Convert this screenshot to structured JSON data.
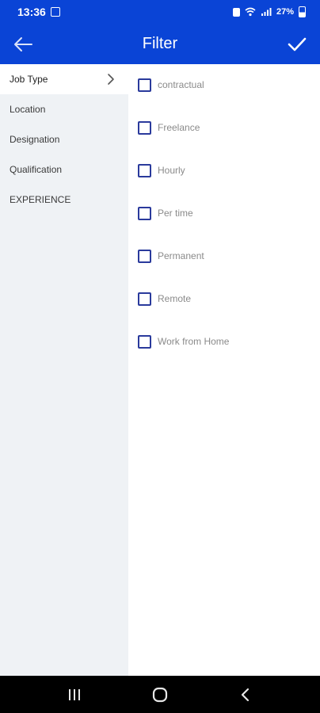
{
  "status_bar": {
    "time": "13:36",
    "battery_text": "27%",
    "icons": [
      "gallery-icon",
      "lock-icon",
      "wifi-icon",
      "signal-icon",
      "battery-icon"
    ]
  },
  "app_bar": {
    "title": "Filter",
    "back_icon": "arrow-left-icon",
    "confirm_icon": "checkmark-icon"
  },
  "sidebar": {
    "items": [
      {
        "label": "Job Type",
        "active": true
      },
      {
        "label": "Location",
        "active": false
      },
      {
        "label": "Designation",
        "active": false
      },
      {
        "label": "Qualification",
        "active": false
      },
      {
        "label": "EXPERIENCE",
        "active": false
      }
    ]
  },
  "options": [
    {
      "label": "contractual",
      "checked": false
    },
    {
      "label": "Freelance",
      "checked": false
    },
    {
      "label": "Hourly",
      "checked": false
    },
    {
      "label": "Per time",
      "checked": false
    },
    {
      "label": "Permanent",
      "checked": false
    },
    {
      "label": "Remote",
      "checked": false
    },
    {
      "label": "Work from Home",
      "checked": false
    }
  ],
  "colors": {
    "primary": "#0a44d6",
    "sidebar_bg": "#eff2f5",
    "checkbox_border": "#2a3a9c"
  },
  "nav_bar": {
    "icons": [
      "recent-apps-icon",
      "home-icon",
      "back-icon"
    ]
  }
}
